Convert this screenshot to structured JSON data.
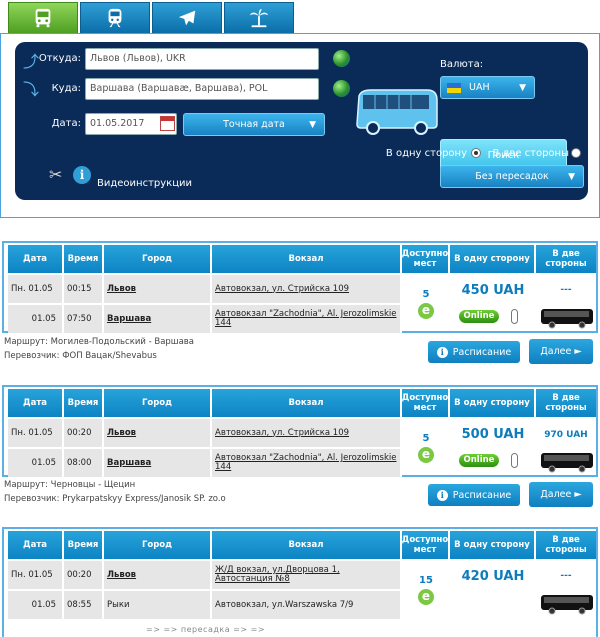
{
  "tabs": [
    {
      "name": "bus",
      "icon": "bus-icon",
      "active": true
    },
    {
      "name": "train",
      "icon": "train-icon",
      "active": false
    },
    {
      "name": "plane",
      "icon": "plane-icon",
      "active": false
    },
    {
      "name": "beach",
      "icon": "palm-icon",
      "active": false
    }
  ],
  "search": {
    "from_label": "Откуда:",
    "from_value": "Львов (Львов), UKR",
    "to_label": "Куда:",
    "to_value": "Варшава (Варшавæ,  Варшава), POL",
    "date_label": "Дата:",
    "date_value": "01.05.2017",
    "date_mode": "Точная дата",
    "currency_label": "Валюта:",
    "currency_value": "UAH",
    "search_button": "Поиск",
    "one_way": "В одну сторону",
    "round_trip": "В две стороны",
    "transfers": "Без пересадок",
    "video": "Видеоинструкции"
  },
  "headers": [
    "Дата",
    "Время",
    "Город",
    "Вокзал",
    "Доступно мест",
    "В одну сторону",
    "В две стороны"
  ],
  "results": [
    {
      "rows": [
        {
          "date": "Пн. 01.05",
          "time": "00:15",
          "city": "Львов",
          "station": "Автовокзал, ул. Стрийска 109"
        },
        {
          "date": "01.05",
          "time": "07:50",
          "city": "Варшава",
          "station": "Автовокзал \"Zachodnia\", Al. Jerozolimskie 144"
        }
      ],
      "seats": "5",
      "price_one": "450 UAH",
      "price_two": "---",
      "online": "Online",
      "route": "Маршрут: Могилев-Подольский - Варшава",
      "carrier": "Перевозчик: ФОП Вацак/Shevabus",
      "schedule": "Расписание",
      "next": "Далее ►"
    },
    {
      "rows": [
        {
          "date": "Пн. 01.05",
          "time": "00:20",
          "city": "Львов",
          "station": "Автовокзал, ул. Стрийска 109"
        },
        {
          "date": "01.05",
          "time": "08:00",
          "city": "Варшава",
          "station": "Автовокзал \"Zachodnia\", Al. Jerozolimskie 144"
        }
      ],
      "seats": "5",
      "price_one": "500 UAH",
      "price_two": "970 UAH",
      "online": "Online",
      "route": "Маршрут: Черновцы - Щецин",
      "carrier": "Перевозчик: Prykarpatskyy Express/Janosik SP. zo.o",
      "schedule": "Расписание",
      "next": "Далее ►"
    },
    {
      "rows": [
        {
          "date": "Пн. 01.05",
          "time": "00:20",
          "city": "Львов",
          "station": "Ж/Д вокзал, ул.Дворцова 1, Автостанция №8"
        },
        {
          "date": "01.05",
          "time": "08:55",
          "city": "Рыки",
          "station": "Автовокзал, ул.Warszawska 7/9"
        }
      ],
      "seats": "15",
      "price_one": "420 UAH",
      "price_two": "---",
      "transfer": "=> => пересадка => =>"
    }
  ]
}
